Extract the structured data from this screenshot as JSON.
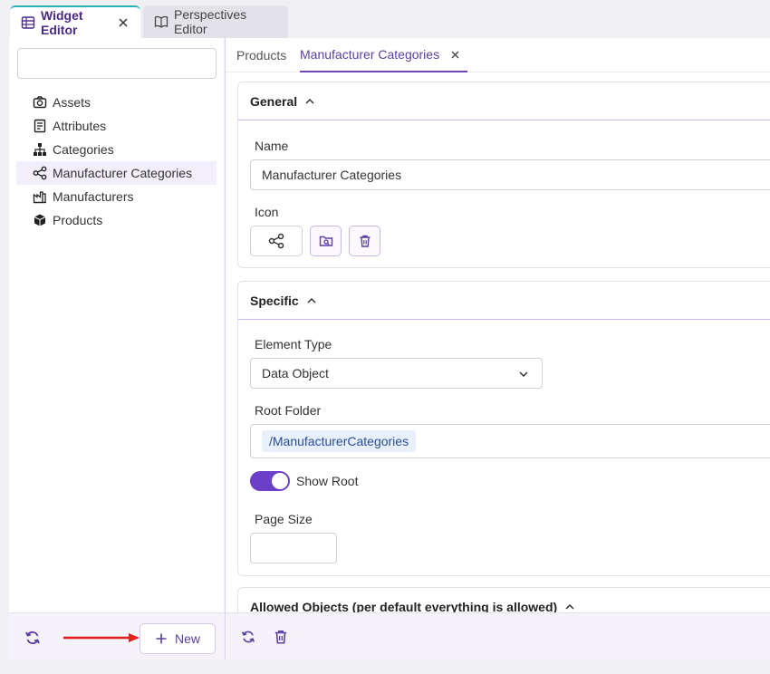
{
  "top_tabs": [
    {
      "label": "Widget Editor",
      "icon": "table-icon",
      "active": true
    },
    {
      "label": "Perspectives Editor",
      "icon": "book-icon",
      "active": false
    }
  ],
  "sidebar": {
    "search_placeholder": "",
    "items": [
      {
        "label": "Assets",
        "icon": "camera-icon"
      },
      {
        "label": "Attributes",
        "icon": "document-icon"
      },
      {
        "label": "Categories",
        "icon": "hierarchy-icon"
      },
      {
        "label": "Manufacturer Categories",
        "icon": "share-icon",
        "selected": true
      },
      {
        "label": "Manufacturers",
        "icon": "factory-icon"
      },
      {
        "label": "Products",
        "icon": "cube-icon"
      }
    ],
    "new_label": "New"
  },
  "sub_tabs": [
    {
      "label": "Products"
    },
    {
      "label": "Manufacturer Categories",
      "active": true
    }
  ],
  "general": {
    "title": "General",
    "name_label": "Name",
    "name_value": "Manufacturer Categories",
    "icon_label": "Icon"
  },
  "specific": {
    "title": "Specific",
    "element_type_label": "Element Type",
    "element_type_value": "Data Object",
    "root_folder_label": "Root Folder",
    "root_folder_value": "/ManufacturerCategories",
    "show_root_label": "Show Root",
    "show_root_on": true,
    "page_size_label": "Page Size",
    "page_size_value": ""
  },
  "allowed": {
    "title": "Allowed Objects (per default everything is allowed)"
  },
  "colors": {
    "accent": "#6c3fc9",
    "active_tab_border": "#2bb3b5",
    "arrow": "#e0201b"
  }
}
